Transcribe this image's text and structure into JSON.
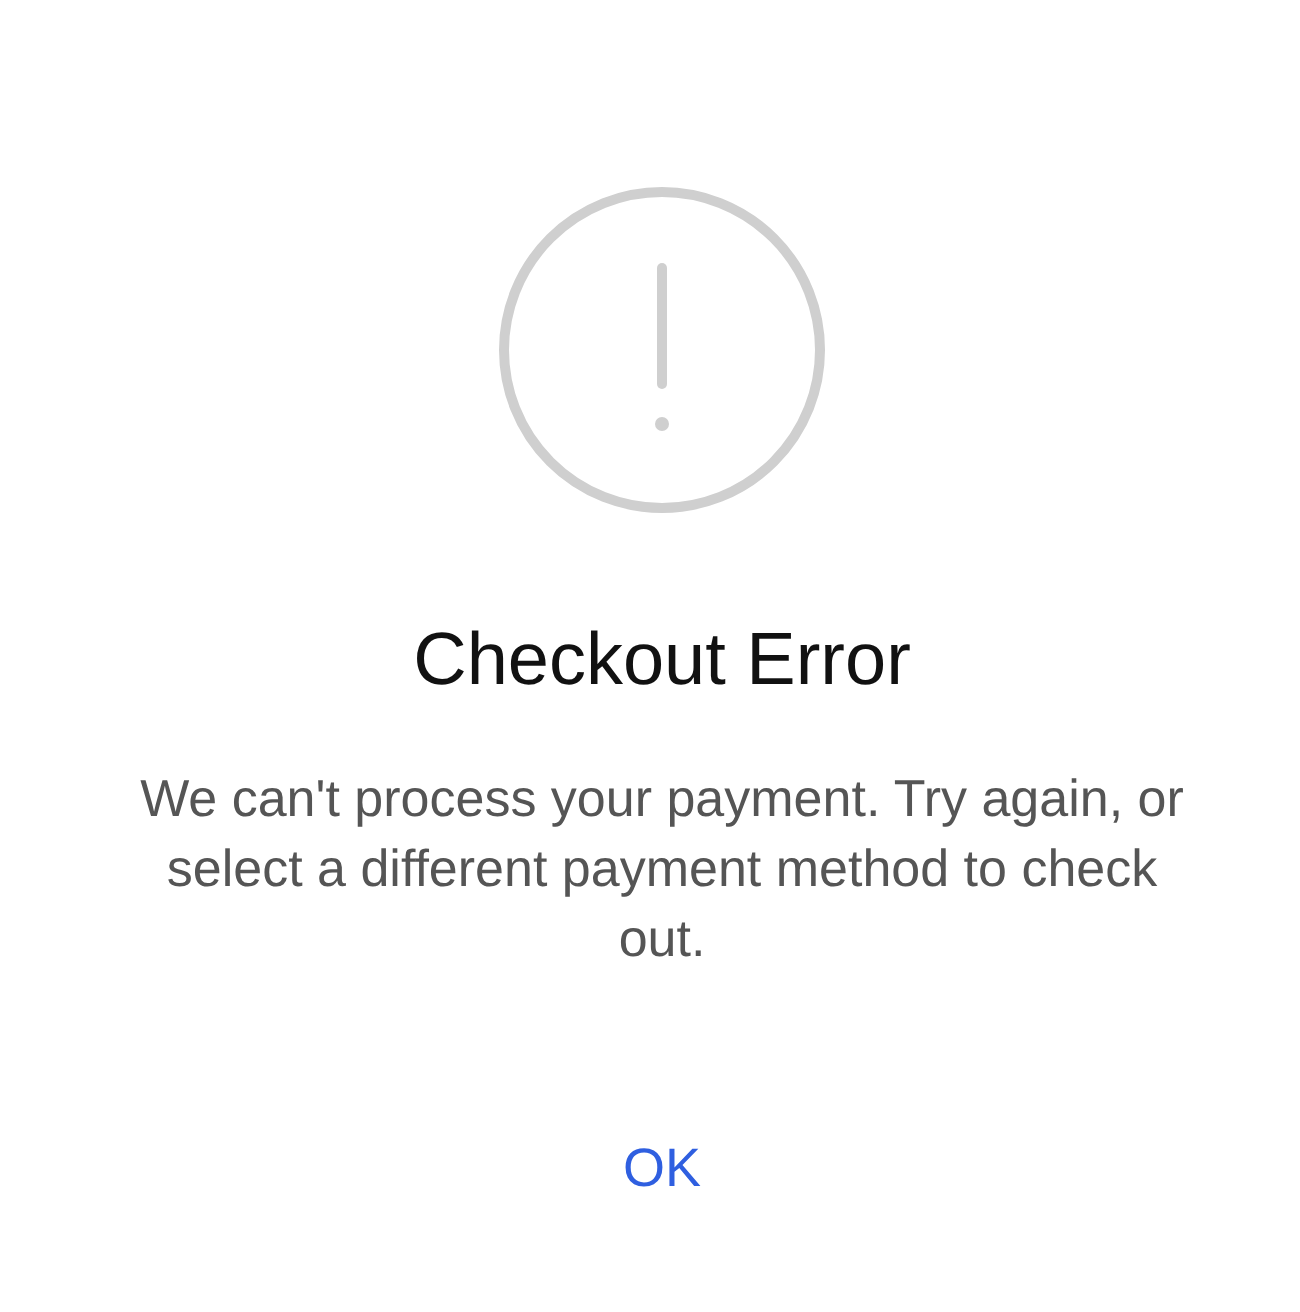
{
  "alert": {
    "title": "Checkout Error",
    "message": "We can't process your payment. Try again, or select a different payment method to check out.",
    "button": "OK"
  }
}
